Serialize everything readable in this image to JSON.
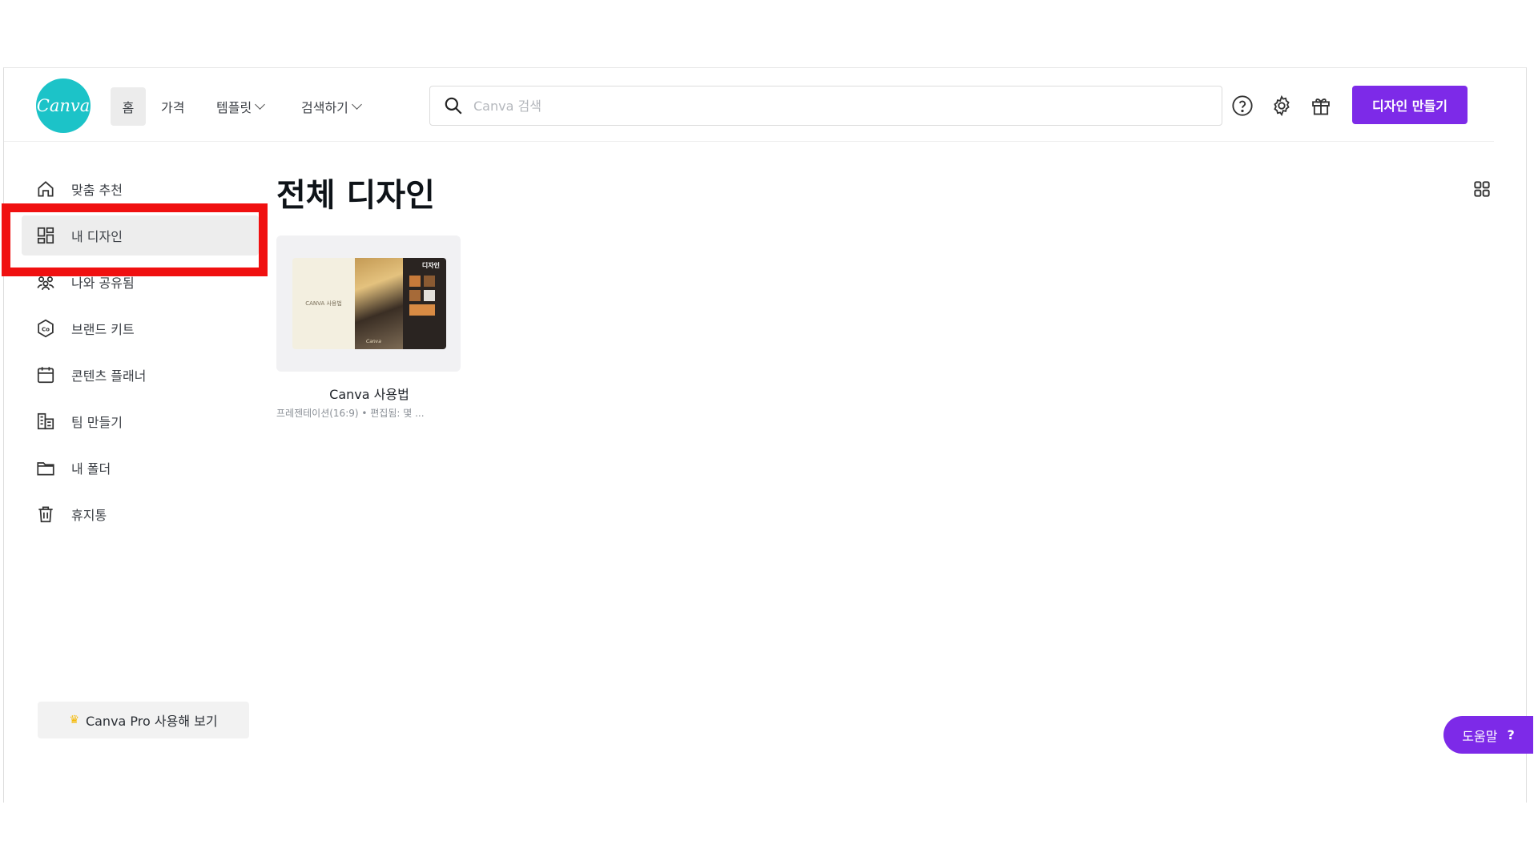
{
  "header": {
    "logo_text": "Canva",
    "nav": [
      {
        "label": "홈",
        "has_dropdown": false
      },
      {
        "label": "가격",
        "has_dropdown": false
      },
      {
        "label": "템플릿",
        "has_dropdown": true
      },
      {
        "label": "검색하기",
        "has_dropdown": true
      }
    ],
    "search_placeholder": "Canva 검색",
    "create_button": "디자인 만들기"
  },
  "sidebar": {
    "items": [
      {
        "label": "맞춤 추천",
        "icon": "home-icon"
      },
      {
        "label": "내 디자인",
        "icon": "my-designs-icon",
        "active": true
      },
      {
        "label": "나와 공유됨",
        "icon": "shared-icon"
      },
      {
        "label": "브랜드 키트",
        "icon": "brand-kit-icon"
      },
      {
        "label": "콘텐츠 플래너",
        "icon": "calendar-icon"
      },
      {
        "label": "팀 만들기",
        "icon": "team-icon"
      },
      {
        "label": "내 폴더",
        "icon": "folder-icon"
      },
      {
        "label": "휴지통",
        "icon": "trash-icon"
      }
    ],
    "pro_button": "Canva Pro 사용해 보기"
  },
  "main": {
    "title": "전체 디자인",
    "designs": [
      {
        "title": "Canva 사용법",
        "meta": "프레젠테이션(16:9) • 편집됨: 몇 ...",
        "thumb_left_text": "CANVA 사용법",
        "thumb_tag": "디자인",
        "thumb_caption": "Canva"
      }
    ]
  },
  "help_button": {
    "label": "도움말",
    "glyph": "?"
  },
  "colors": {
    "brand_teal": "#1cc3c8",
    "accent_purple": "#7d2ae8",
    "highlight_red": "#f01010"
  }
}
